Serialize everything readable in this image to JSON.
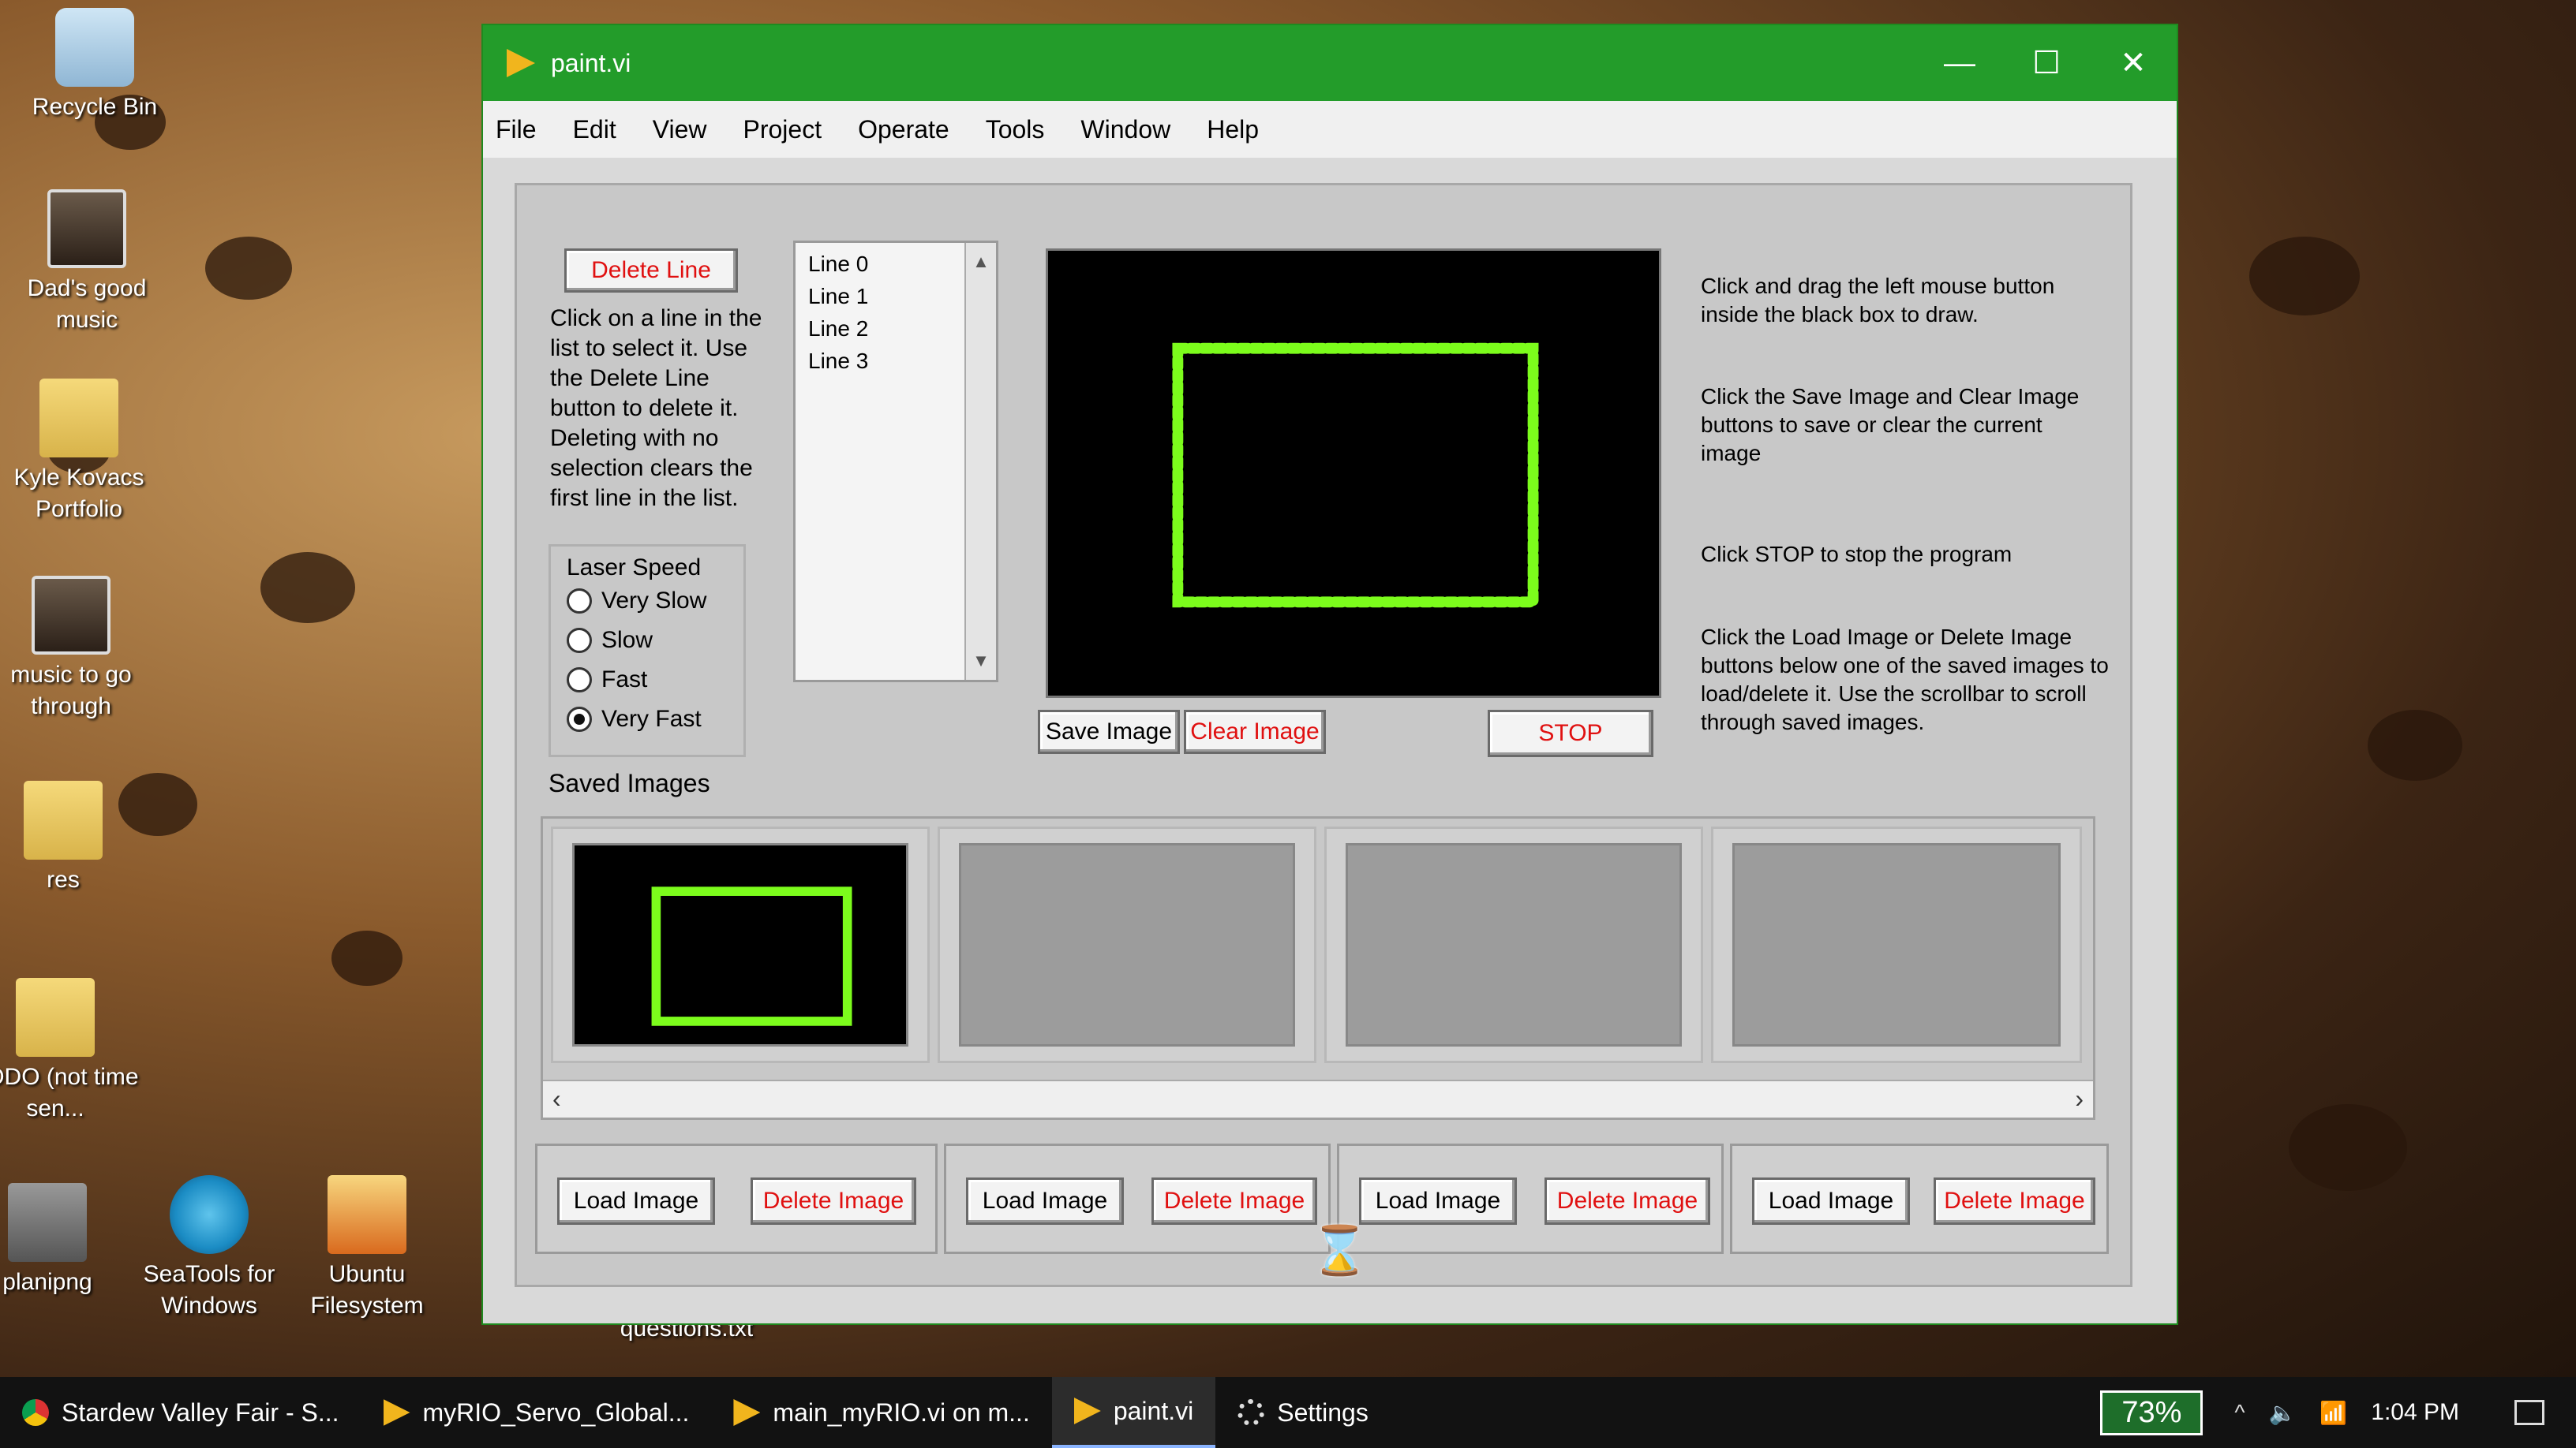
{
  "desktop": {
    "icons": [
      {
        "label": "Recycle Bin",
        "icon": "recycle-bin-icon"
      },
      {
        "label": "Dad's good music",
        "icon": "music-folder-icon"
      },
      {
        "label": "Kyle Kovacs Portfolio",
        "icon": "folder-icon"
      },
      {
        "label": "music to go through",
        "icon": "music-folder-icon"
      },
      {
        "label": "res",
        "icon": "folder-icon"
      },
      {
        "label": "TODO (not time sen...",
        "icon": "folder-icon"
      },
      {
        "label": "planipng",
        "icon": "image-file-icon"
      },
      {
        "label": "SeaTools for Windows",
        "icon": "seatools-icon"
      },
      {
        "label": "Ubuntu Filesystem",
        "icon": "folder-shortcut-icon"
      },
      {
        "label": "questions.txt",
        "icon": "text-file-icon"
      }
    ]
  },
  "window": {
    "title": "paint.vi",
    "minimize": "—",
    "maximize": "☐",
    "close": "✕"
  },
  "menu": [
    "File",
    "Edit",
    "View",
    "Project",
    "Operate",
    "Tools",
    "Window",
    "Help"
  ],
  "left_panel": {
    "delete_line_button": "Delete Line",
    "delete_line_help": "Click on a line in the list to select it. Use the Delete Line button to delete it. Deleting with no selection clears the first line in the list."
  },
  "lines_list": [
    "Line 0",
    "Line 1",
    "Line 2",
    "Line 3"
  ],
  "laser_speed": {
    "title": "Laser Speed",
    "options": [
      "Very Slow",
      "Slow",
      "Fast",
      "Very Fast"
    ],
    "selected": "Very Fast"
  },
  "canvas_buttons": {
    "save": "Save Image",
    "clear": "Clear Image",
    "stop": "STOP"
  },
  "instructions": {
    "draw": "Click and drag the left mouse button inside the black box to draw.",
    "save_clear": "Click the Save Image and Clear Image buttons to save or clear the current image",
    "stop": "Click STOP to stop the program",
    "load_delete": "Click the Load Image or Delete Image buttons below one of the saved images to load/delete it. Use the scrollbar to scroll through saved images."
  },
  "saved_images": {
    "label": "Saved Images",
    "slots": [
      {
        "load": "Load Image",
        "delete": "Delete Image",
        "has_image": true
      },
      {
        "load": "Load Image",
        "delete": "Delete Image",
        "has_image": false
      },
      {
        "load": "Load Image",
        "delete": "Delete Image",
        "has_image": false
      },
      {
        "load": "Load Image",
        "delete": "Delete Image",
        "has_image": false
      }
    ]
  },
  "colors": {
    "titlebar": "#239c2a",
    "drawing_stroke": "#7cfc1c",
    "delete_text": "#e01010"
  },
  "taskbar": {
    "tasks": [
      {
        "label": "Stardew Valley Fair - S...",
        "icon": "chrome-icon"
      },
      {
        "label": "myRIO_Servo_Global...",
        "icon": "labview-icon"
      },
      {
        "label": "main_myRIO.vi on m...",
        "icon": "labview-icon"
      },
      {
        "label": "paint.vi",
        "icon": "labview-icon",
        "active": true
      },
      {
        "label": "Settings",
        "icon": "gear-icon"
      }
    ],
    "battery": "73%",
    "clock": "1:04 PM"
  }
}
